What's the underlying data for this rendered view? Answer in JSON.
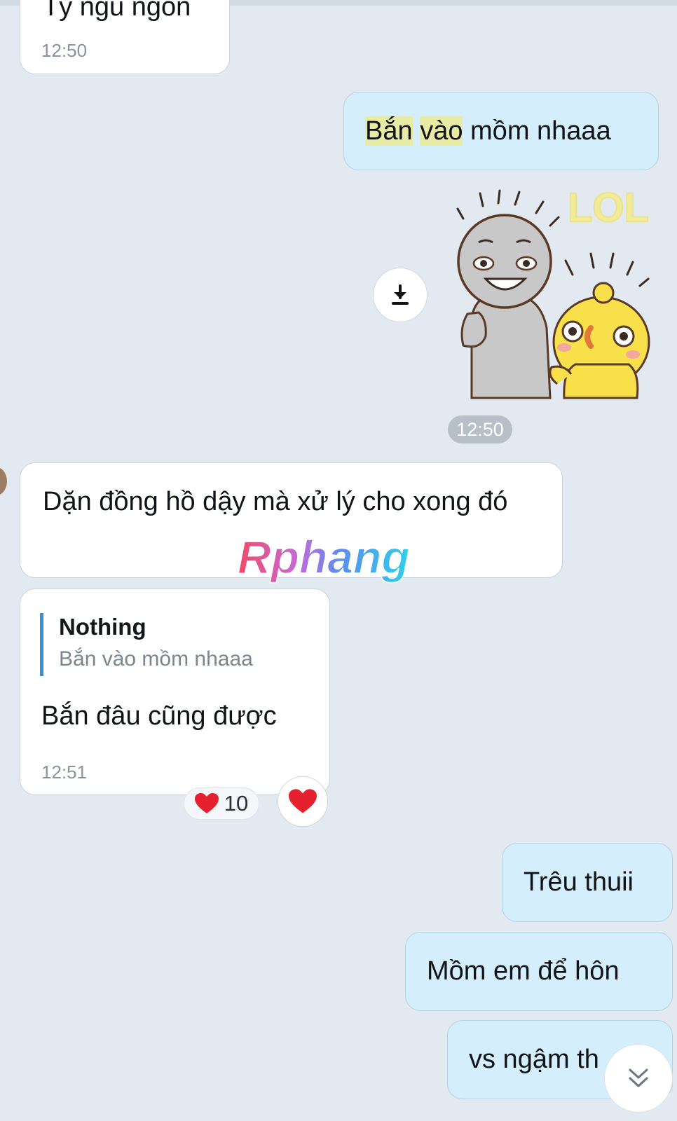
{
  "chat": {
    "messages": [
      {
        "text": "Tý ngủ ngon",
        "time": "12:50"
      },
      {
        "parts": [
          "Bắn",
          "vào",
          "mồm nhaaa"
        ]
      },
      {
        "sticker_time": "12:50"
      },
      {
        "text": "Dặn đồng hồ dậy mà xử lý cho xong đó"
      },
      {
        "reply_author": "Nothing",
        "reply_text": "Bắn vào mồm nhaaa",
        "text": "Bắn đâu cũng được",
        "time": "12:51",
        "reaction_count": "10"
      },
      {
        "text": "Trêu thuii"
      },
      {
        "text": "Mồm em để hôn"
      },
      {
        "text": "vs ngậm th"
      }
    ]
  },
  "sticker": {
    "caption": "LOL"
  },
  "watermark": {
    "text": "Rphang"
  },
  "icons": {
    "download": "download-icon",
    "heart": "heart-icon",
    "scroll": "double-chevron-down-icon"
  },
  "colors": {
    "background": "#e2e9f1",
    "incoming": "#ffffff",
    "outgoing": "#d4eefc",
    "highlight": "#e8eba3",
    "reply_bar": "#3d8fd8",
    "heart": "#e5202f"
  }
}
